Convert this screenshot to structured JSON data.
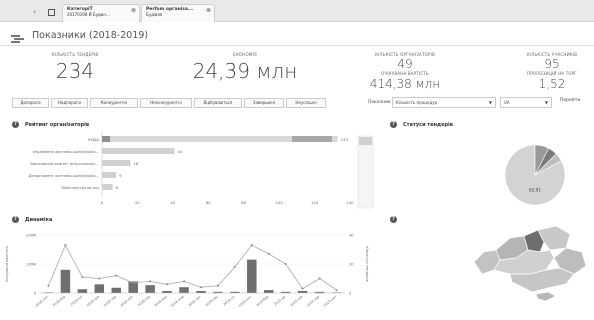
{
  "tabs": [
    {
      "title": "КатегоріТ",
      "subtitle": "20170198 Й Будин..."
    },
    {
      "title": "Perfom організа...",
      "subtitle": "Будівля"
    }
  ],
  "header": {
    "title": "Показники (2018-2019)"
  },
  "kpis": {
    "tenders_label": "КІЛЬКІСТЬ ТЕНДЕРІВ",
    "tenders_value": "234",
    "savings_label": "ЕКОНОМІЯ",
    "savings_value": "24,39 млн",
    "organizers_label": "КІЛЬКІСТЬ ОРГАНІЗАТОРІВ",
    "organizers_value": "49",
    "expected_label": "ОЧІКУВАНА ВАРТІСТЬ",
    "expected_value": "414,38 млн",
    "participants_label": "КІЛЬКІСТЬ УЧАСНИКІВ",
    "participants_value": "95",
    "proposals_label": "ПРОПОЗИЦІЙ НА ТОРГ",
    "proposals_value": "1,52"
  },
  "filters": [
    "Допороги",
    "Надпороги",
    "Конкурентні",
    "Неконкурентні",
    "Відбуваються",
    "Завершені",
    "Неуспішні"
  ],
  "controls": {
    "indicators_label": "Показник",
    "indicator_select": "Кількість процедур",
    "currency_select": "UA",
    "go_label": "Перейти"
  },
  "sections": {
    "ranking_title": "Рейтинг організаторів",
    "status_title": "Статуси тендерів",
    "dynamics_title": "Динаміка"
  },
  "chart_data": [
    {
      "type": "bar",
      "orientation": "horizontal",
      "title": "Рейтинг організаторів",
      "categories": [
        "КМДА",
        "Управління житлово-комунально...",
        "Виконавчий комітет Іртішськолоїч...",
        "Департамент житлово-комунально...",
        "Міністерство юстиц"
      ],
      "values": [
        133,
        41,
        16,
        8,
        6
      ],
      "value_labels": [
        "133",
        "41",
        "16",
        "9",
        "6"
      ],
      "x_ticks": [
        "0",
        "20",
        "40",
        "60",
        "80",
        "100",
        "120",
        "140"
      ],
      "xlim": [
        0,
        140
      ]
    },
    {
      "type": "pie",
      "title": "Статуси тендерів",
      "slices": [
        {
          "label": "82,91",
          "value": 82.91,
          "color": "#d3d3d3"
        },
        {
          "label": "",
          "value": 7.5,
          "color": "#9a9a9a"
        },
        {
          "label": "",
          "value": 5.0,
          "color": "#7b7b7b"
        },
        {
          "label": "",
          "value": 4.59,
          "color": "#bdbdbd"
        }
      ]
    },
    {
      "type": "bar+line",
      "title": "Динаміка",
      "ylabel": "Очікувана вартість",
      "y2label": "Кількість тендерів",
      "y_ticks": [
        "200M",
        "100M",
        "0"
      ],
      "y2_ticks": [
        "40",
        "20",
        "0"
      ],
      "categories": [
        "2018-лют",
        "2018-бер",
        "2018-кві",
        "2018-тра",
        "2018-чер",
        "2018-лип",
        "2018-сер",
        "2018-вер",
        "2018-жов",
        "2018-лис",
        "2018-гру",
        "2019-січ",
        "2019-лют",
        "2019-бер",
        "2019-кві",
        "2019-тра",
        "2019-чер",
        "2019-лип"
      ],
      "bars": [
        2,
        80,
        13,
        30,
        18,
        40,
        27,
        7,
        20,
        7,
        4,
        4,
        115,
        10,
        4,
        7,
        4,
        2
      ],
      "line": [
        5,
        33,
        11,
        10,
        12,
        7,
        8,
        6,
        8,
        4,
        5,
        18,
        33,
        27,
        20,
        3,
        10,
        2
      ],
      "ylim": [
        0,
        200
      ],
      "y2lim": [
        0,
        40
      ]
    }
  ]
}
